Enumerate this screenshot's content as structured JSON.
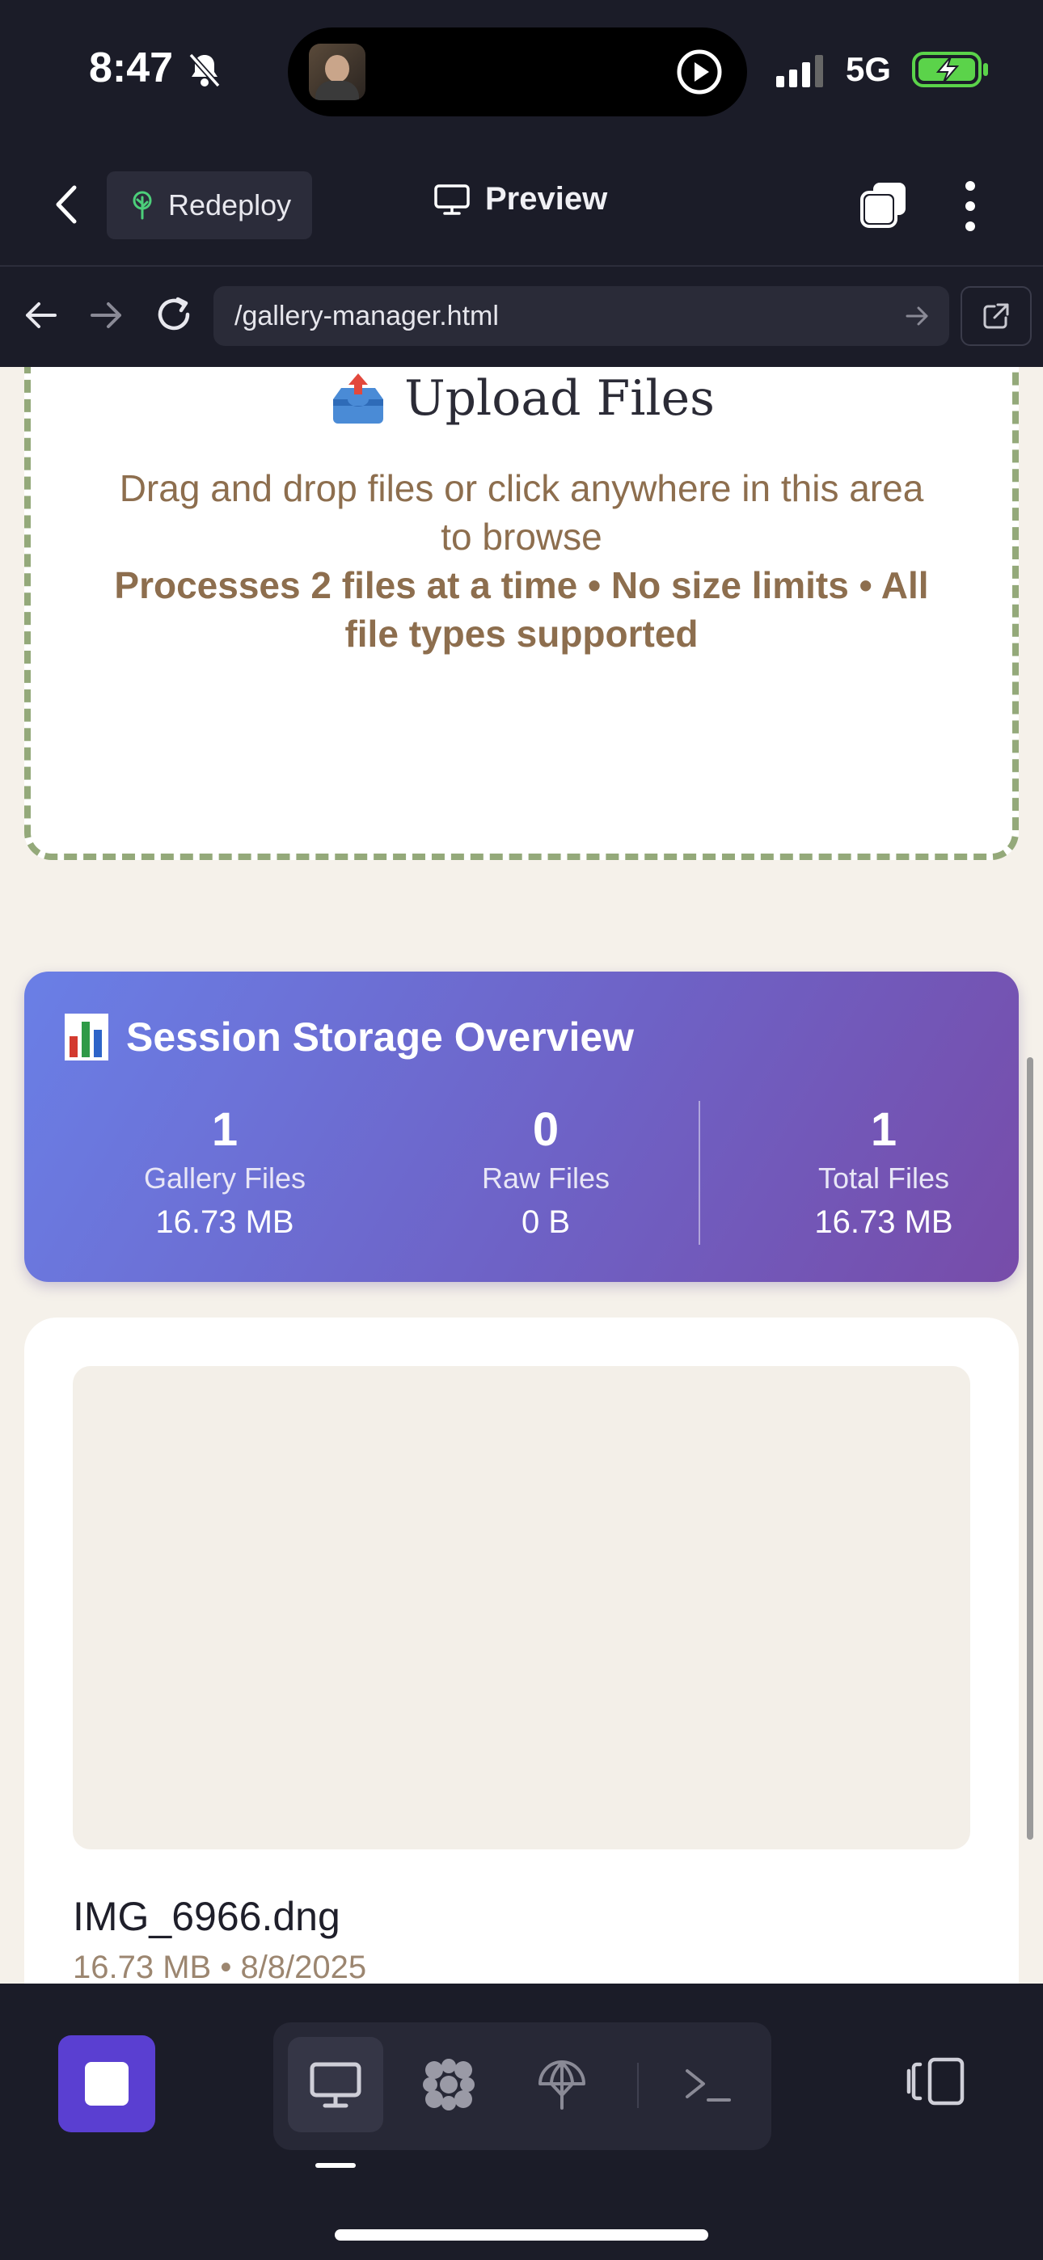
{
  "status_bar": {
    "time": "8:47",
    "network": "5G"
  },
  "app_bar": {
    "redeploy_label": "Redeploy",
    "title": "Preview"
  },
  "browser": {
    "url": "/gallery-manager.html"
  },
  "upload": {
    "title": "Upload Files",
    "description": "Drag and drop files or click anywhere in this area to browse",
    "note": "Processes 2 files at a time • No size limits • All file types supported"
  },
  "storage": {
    "title": "Session Storage Overview",
    "stats": [
      {
        "count": "1",
        "label": "Gallery Files",
        "size": "16.73 MB"
      },
      {
        "count": "0",
        "label": "Raw Files",
        "size": "0 B"
      },
      {
        "count": "1",
        "label": "Total Files",
        "size": "16.73 MB"
      }
    ]
  },
  "file": {
    "name": "IMG_6966.dng",
    "meta": "16.73 MB • 8/8/2025"
  },
  "colors": {
    "background": "#1b1c28",
    "page": "#f5f1ea",
    "accent": "#5a3fd1",
    "dropzone_border": "#94a97a",
    "card_gradient_start": "#6a7fe6",
    "card_gradient_end": "#774ca9"
  },
  "icons": [
    "bell-slash-icon",
    "play-circle-icon",
    "signal-icon",
    "battery-charging-icon",
    "chevron-left-icon",
    "tree-icon",
    "monitor-icon",
    "tabs-icon",
    "more-vertical-icon",
    "arrow-left-icon",
    "arrow-right-icon",
    "reload-icon",
    "open-external-icon",
    "inbox-tray-icon",
    "bar-chart-icon",
    "stop-icon",
    "desktop-icon",
    "grid-icon",
    "deploy-icon",
    "terminal-icon",
    "split-view-icon"
  ]
}
